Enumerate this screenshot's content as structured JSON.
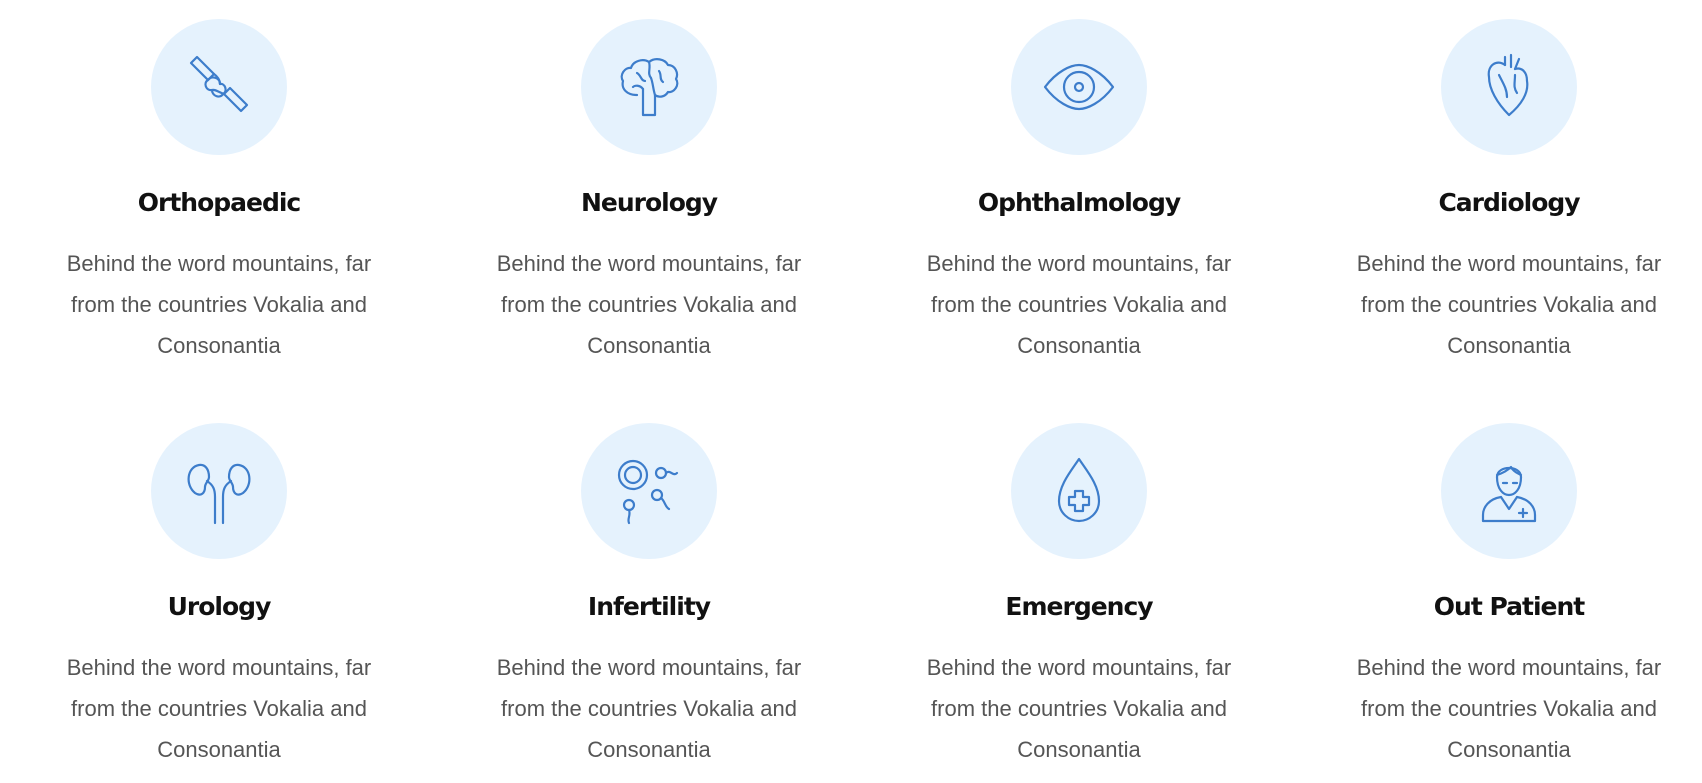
{
  "colors": {
    "icon_stroke": "#3d7dcb",
    "icon_bg": "#e5f2fd",
    "title": "#111111",
    "text": "#555555"
  },
  "services": [
    {
      "title": "Orthopaedic",
      "icon": "bone-icon",
      "description": "Behind the word mountains, far from the countries Vokalia and Consonantia"
    },
    {
      "title": "Neurology",
      "icon": "brain-icon",
      "description": "Behind the word mountains, far from the countries Vokalia and Consonantia"
    },
    {
      "title": "Ophthalmology",
      "icon": "eye-icon",
      "description": "Behind the word mountains, far from the countries Vokalia and Consonantia"
    },
    {
      "title": "Cardiology",
      "icon": "heart-icon",
      "description": "Behind the word mountains, far from the countries Vokalia and Consonantia"
    },
    {
      "title": "Urology",
      "icon": "kidneys-icon",
      "description": "Behind the word mountains, far from the countries Vokalia and Consonantia"
    },
    {
      "title": "Infertility",
      "icon": "fertility-icon",
      "description": "Behind the word mountains, far from the countries Vokalia and Consonantia"
    },
    {
      "title": "Emergency",
      "icon": "blood-drop-icon",
      "description": "Behind the word mountains, far from the countries Vokalia and Consonantia"
    },
    {
      "title": "Out Patient",
      "icon": "doctor-icon",
      "description": "Behind the word mountains, far from the countries Vokalia and Consonantia"
    }
  ]
}
